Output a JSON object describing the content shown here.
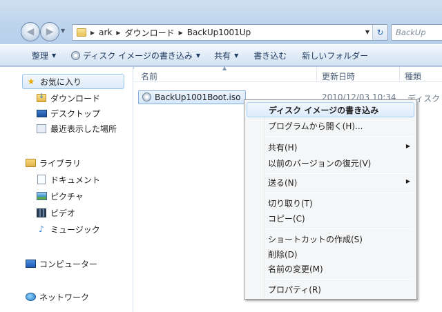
{
  "address": {
    "crumbs": [
      "ark",
      "ダウンロード",
      "BackUp1001Up"
    ],
    "search_placeholder": "BackUp"
  },
  "toolbar": {
    "organize": "整理",
    "burn": "ディスク イメージの書き込み",
    "share": "共有",
    "write": "書き込む",
    "new_folder": "新しいフォルダー"
  },
  "nav": {
    "favorites": "お気に入り",
    "downloads": "ダウンロード",
    "desktop": "デスクトップ",
    "recent": "最近表示した場所",
    "libraries": "ライブラリ",
    "documents": "ドキュメント",
    "pictures": "ピクチャ",
    "videos": "ビデオ",
    "music": "ミュージック",
    "computer": "コンピューター",
    "network": "ネットワーク"
  },
  "columns": {
    "name": "名前",
    "date": "更新日時",
    "type": "種類"
  },
  "file": {
    "name": "BackUp1001Boot.iso",
    "date": "2010/12/03 10:34",
    "type": "ディスク"
  },
  "menu": {
    "burn": "ディスク イメージの書き込み",
    "open_with": "プログラムから開く(H)...",
    "share": "共有(H)",
    "restore": "以前のバージョンの復元(V)",
    "send_to": "送る(N)",
    "cut": "切り取り(T)",
    "copy": "コピー(C)",
    "shortcut": "ショートカットの作成(S)",
    "delete": "削除(D)",
    "rename": "名前の変更(M)",
    "properties": "プロパティ(R)"
  }
}
